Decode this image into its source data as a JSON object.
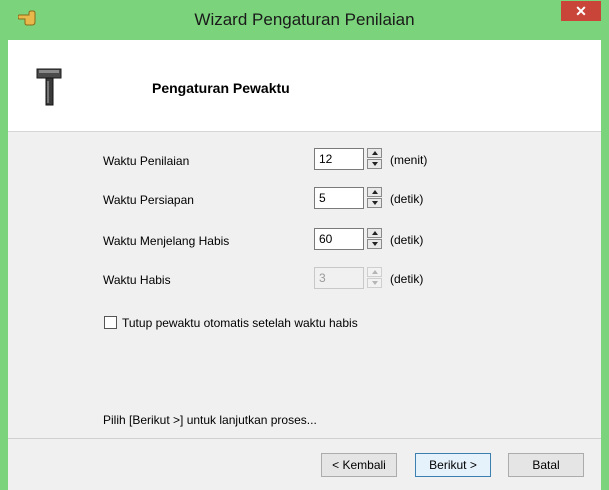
{
  "window": {
    "title": "Wizard Pengaturan Penilaian",
    "close_glyph": "✕",
    "title_icon": "pointing-hand-icon"
  },
  "header": {
    "title": "Pengaturan Pewaktu",
    "icon": "hammer-icon"
  },
  "fields": [
    {
      "label": "Waktu Penilaian",
      "value": "12",
      "unit": "(menit)",
      "enabled": true
    },
    {
      "label": "Waktu Persiapan",
      "value": "5",
      "unit": "(detik)",
      "enabled": true
    },
    {
      "label": "Waktu Menjelang Habis",
      "value": "60",
      "unit": "(detik)",
      "enabled": true
    },
    {
      "label": "Waktu Habis",
      "value": "3",
      "unit": "(detik)",
      "enabled": false
    }
  ],
  "auto_close": {
    "label": "Tutup pewaktu otomatis setelah waktu habis",
    "checked": false
  },
  "hint": "Pilih [Berikut >] untuk lanjutkan proses...",
  "buttons": {
    "back": "< Kembali",
    "next": "Berikut >",
    "cancel": "Batal"
  },
  "colors": {
    "frame": "#7bd47b",
    "close": "#c9453a",
    "client": "#f0f0f0",
    "default_button_border": "#3c7fb1"
  }
}
